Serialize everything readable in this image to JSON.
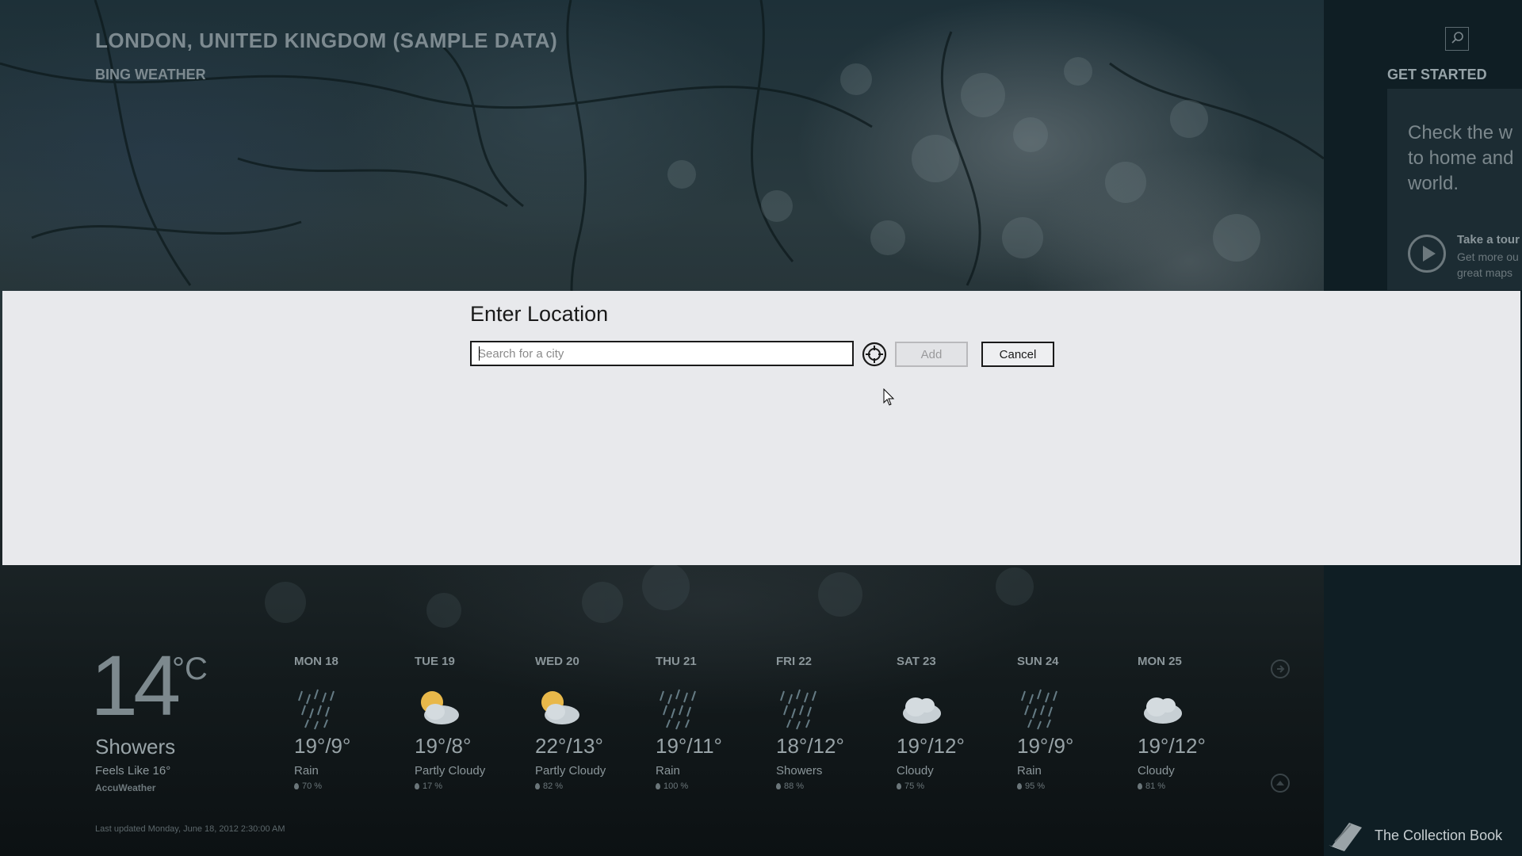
{
  "header": {
    "city": "LONDON, UNITED KINGDOM (SAMPLE DATA)",
    "app": "BING WEATHER"
  },
  "side": {
    "title": "GET STARTED",
    "card_text": "Check the w\nto home and\nworld.",
    "tour_title": "Take a tour",
    "tour_desc": "Get more ou\ngreat maps"
  },
  "dialog": {
    "title": "Enter Location",
    "placeholder": "Search for a city",
    "add_label": "Add",
    "cancel_label": "Cancel"
  },
  "current": {
    "temp": "14",
    "unit": "°C",
    "condition": "Showers",
    "feels_like": "Feels Like 16°",
    "source": "AccuWeather",
    "last_updated": "Last updated Monday, June 18, 2012 2:30:00 AM"
  },
  "forecast": [
    {
      "day": "MON 18",
      "temp": "19°/9°",
      "cond": "Rain",
      "precip": "70 %",
      "icon": "rain-icon"
    },
    {
      "day": "TUE 19",
      "temp": "19°/8°",
      "cond": "Partly Cloudy",
      "precip": "17 %",
      "icon": "partly-cloudy-icon"
    },
    {
      "day": "WED 20",
      "temp": "22°/13°",
      "cond": "Partly Cloudy",
      "precip": "82 %",
      "icon": "partly-cloudy-icon"
    },
    {
      "day": "THU 21",
      "temp": "19°/11°",
      "cond": "Rain",
      "precip": "100 %",
      "icon": "rain-icon"
    },
    {
      "day": "FRI 22",
      "temp": "18°/12°",
      "cond": "Showers",
      "precip": "88 %",
      "icon": "rain-icon"
    },
    {
      "day": "SAT 23",
      "temp": "19°/12°",
      "cond": "Cloudy",
      "precip": "75 %",
      "icon": "cloud-icon"
    },
    {
      "day": "SUN 24",
      "temp": "19°/9°",
      "cond": "Rain",
      "precip": "95 %",
      "icon": "rain-icon"
    },
    {
      "day": "MON 25",
      "temp": "19°/12°",
      "cond": "Cloudy",
      "precip": "81 %",
      "icon": "cloud-icon"
    }
  ],
  "taskbar": {
    "collection_label": "The Collection Book"
  }
}
